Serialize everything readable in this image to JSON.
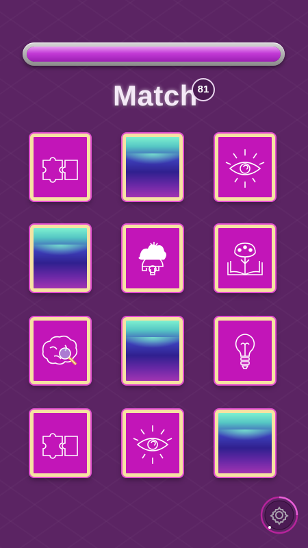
{
  "header": {
    "title": "Match",
    "badge_count": "81",
    "progress_fraction": 1.0
  },
  "cards": [
    {
      "state": "face-up",
      "icon": "puzzle-icon"
    },
    {
      "state": "face-down",
      "icon": "card-back"
    },
    {
      "state": "face-up",
      "icon": "eye-icon"
    },
    {
      "state": "face-down",
      "icon": "card-back"
    },
    {
      "state": "face-up",
      "icon": "gear-brain-icon"
    },
    {
      "state": "face-up",
      "icon": "book-tree-icon"
    },
    {
      "state": "face-up",
      "icon": "brain-magnifier-icon"
    },
    {
      "state": "face-down",
      "icon": "card-back"
    },
    {
      "state": "face-up",
      "icon": "lightbulb-icon"
    },
    {
      "state": "face-up",
      "icon": "puzzle-icon"
    },
    {
      "state": "face-up",
      "icon": "eye-icon"
    },
    {
      "state": "face-down",
      "icon": "card-back"
    }
  ],
  "colors": {
    "background": "#5b2463",
    "card_face": "#c215b8",
    "card_border": "#f6e3a2",
    "progress_fill": "#c33ad6"
  },
  "settings": {
    "icon": "gear-icon"
  }
}
